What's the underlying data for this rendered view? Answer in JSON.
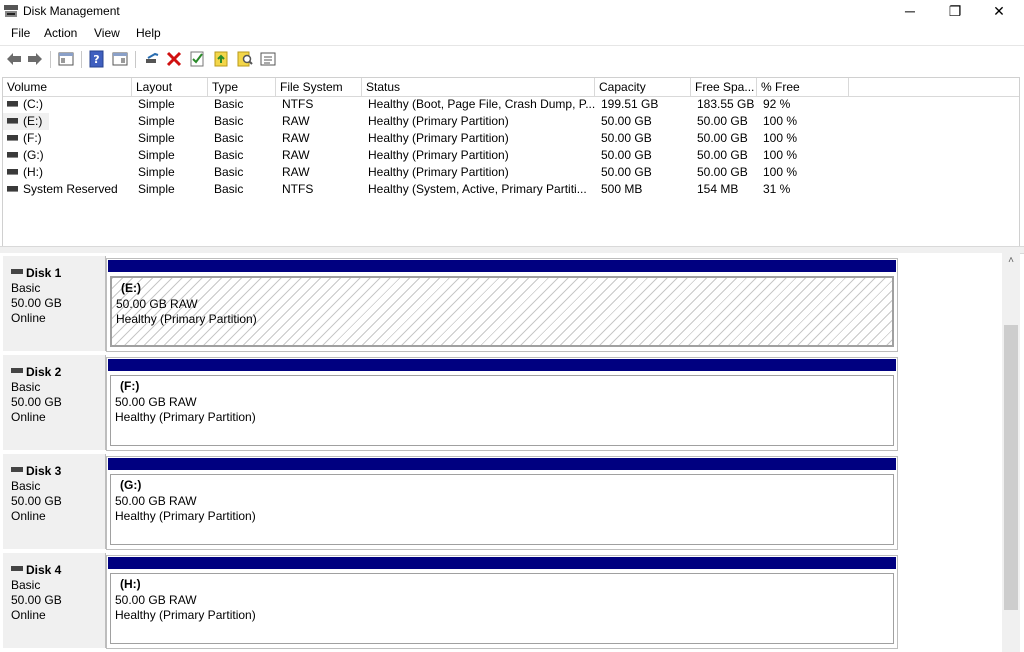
{
  "window": {
    "title": "Disk Management",
    "controls": {
      "minimize": "─",
      "maximize": "❐",
      "close": "✕"
    }
  },
  "menu": [
    "File",
    "Action",
    "View",
    "Help"
  ],
  "toolbar": {
    "icons": [
      "back-icon",
      "forward-icon",
      "console-tree-icon",
      "help-icon",
      "show-hide-action-pane-icon",
      "connect-icon",
      "delete-icon",
      "properties-icon",
      "export-icon",
      "search-icon",
      "list-view-icon"
    ]
  },
  "volume_table": {
    "columns": [
      "Volume",
      "Layout",
      "Type",
      "File System",
      "Status",
      "Capacity",
      "Free Spa...",
      "% Free"
    ],
    "rows": [
      [
        "(C:)",
        "Simple",
        "Basic",
        "NTFS",
        "Healthy (Boot, Page File, Crash Dump, P...",
        "199.51 GB",
        "183.55 GB",
        "92 %"
      ],
      [
        "(E:)",
        "Simple",
        "Basic",
        "RAW",
        "Healthy (Primary Partition)",
        "50.00 GB",
        "50.00 GB",
        "100 %"
      ],
      [
        "(F:)",
        "Simple",
        "Basic",
        "RAW",
        "Healthy (Primary Partition)",
        "50.00 GB",
        "50.00 GB",
        "100 %"
      ],
      [
        "(G:)",
        "Simple",
        "Basic",
        "RAW",
        "Healthy (Primary Partition)",
        "50.00 GB",
        "50.00 GB",
        "100 %"
      ],
      [
        "(H:)",
        "Simple",
        "Basic",
        "RAW",
        "Healthy (Primary Partition)",
        "50.00 GB",
        "50.00 GB",
        "100 %"
      ],
      [
        "System Reserved",
        "Simple",
        "Basic",
        "NTFS",
        "Healthy (System, Active, Primary Partiti...",
        "500 MB",
        "154 MB",
        "31 %"
      ]
    ]
  },
  "disks": [
    {
      "name": "Disk 1",
      "type": "Basic",
      "size": "50.00 GB",
      "state": "Online",
      "partition": {
        "label": "(E:)",
        "info": "50.00 GB RAW",
        "status": "Healthy (Primary Partition)",
        "selected": true
      }
    },
    {
      "name": "Disk 2",
      "type": "Basic",
      "size": "50.00 GB",
      "state": "Online",
      "partition": {
        "label": "(F:)",
        "info": "50.00 GB RAW",
        "status": "Healthy (Primary Partition)",
        "selected": false
      }
    },
    {
      "name": "Disk 3",
      "type": "Basic",
      "size": "50.00 GB",
      "state": "Online",
      "partition": {
        "label": "(G:)",
        "info": "50.00 GB RAW",
        "status": "Healthy (Primary Partition)",
        "selected": false
      }
    },
    {
      "name": "Disk 4",
      "type": "Basic",
      "size": "50.00 GB",
      "state": "Online",
      "partition": {
        "label": "(H:)",
        "info": "50.00 GB RAW",
        "status": "Healthy (Primary Partition)",
        "selected": false
      }
    }
  ],
  "colors": {
    "partition_band": "#000080",
    "selection": "#f0f0f0"
  }
}
